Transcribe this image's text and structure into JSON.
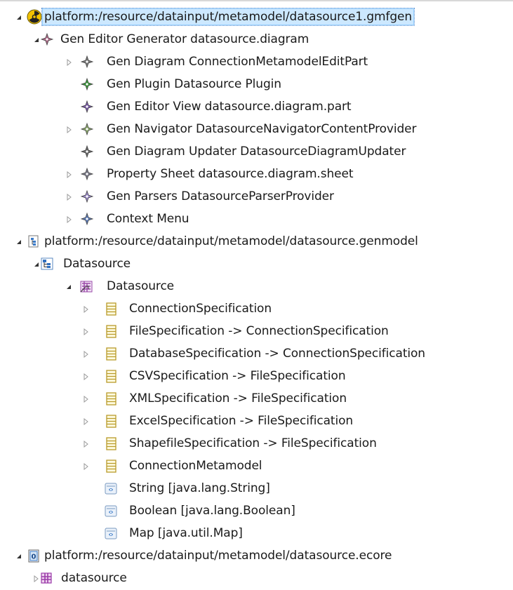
{
  "colors": {
    "gen_icon": "#6a6a9a",
    "green_icon": "#3a9a3a",
    "purple_icon": "#7a5aa8",
    "class_icon": "#b89a2a",
    "selection": "#cce8ff"
  },
  "tree": [
    {
      "icon": "radiation-icon",
      "expanded": true,
      "twisty": true,
      "label": "platform:/resource/datainput/metamodel/datasource1.gmfgen",
      "selected": true
    },
    {
      "icon": "gen-editor-generator-icon",
      "expanded": true,
      "twisty": true,
      "label": "Gen Editor Generator datasource.diagram"
    },
    {
      "icon": "gen-diagram-icon",
      "expanded": false,
      "twisty": true,
      "label": "Gen Diagram ConnectionMetamodelEditPart"
    },
    {
      "icon": "gen-plugin-icon",
      "expanded": false,
      "twisty": false,
      "label": "Gen Plugin Datasource Plugin"
    },
    {
      "icon": "gen-editor-view-icon",
      "expanded": false,
      "twisty": false,
      "label": "Gen Editor View datasource.diagram.part"
    },
    {
      "icon": "gen-navigator-icon",
      "expanded": false,
      "twisty": true,
      "label": "Gen Navigator DatasourceNavigatorContentProvider"
    },
    {
      "icon": "gen-diagram-updater-icon",
      "expanded": false,
      "twisty": false,
      "label": "Gen Diagram Updater DatasourceDiagramUpdater"
    },
    {
      "icon": "property-sheet-icon",
      "expanded": false,
      "twisty": true,
      "label": "Property Sheet datasource.diagram.sheet"
    },
    {
      "icon": "gen-parsers-icon",
      "expanded": false,
      "twisty": true,
      "label": "Gen Parsers DatasourceParserProvider"
    },
    {
      "icon": "context-menu-icon",
      "expanded": false,
      "twisty": true,
      "label": "Context Menu"
    },
    {
      "icon": "genmodel-file-icon",
      "expanded": true,
      "twisty": true,
      "label": "platform:/resource/datainput/metamodel/datasource.genmodel"
    },
    {
      "icon": "gen-package-icon",
      "expanded": true,
      "twisty": true,
      "label": "Datasource"
    },
    {
      "icon": "ecore-package-icon",
      "expanded": true,
      "twisty": true,
      "label": "Datasource"
    },
    {
      "icon": "class-icon",
      "expanded": false,
      "twisty": true,
      "label": "ConnectionSpecification"
    },
    {
      "icon": "class-icon",
      "expanded": false,
      "twisty": true,
      "label": "FileSpecification -> ConnectionSpecification"
    },
    {
      "icon": "class-icon",
      "expanded": false,
      "twisty": true,
      "label": "DatabaseSpecification -> ConnectionSpecification"
    },
    {
      "icon": "class-icon",
      "expanded": false,
      "twisty": true,
      "label": "CSVSpecification -> FileSpecification"
    },
    {
      "icon": "class-icon",
      "expanded": false,
      "twisty": true,
      "label": "XMLSpecification -> FileSpecification"
    },
    {
      "icon": "class-icon",
      "expanded": false,
      "twisty": true,
      "label": "ExcelSpecification -> FileSpecification"
    },
    {
      "icon": "class-icon",
      "expanded": false,
      "twisty": true,
      "label": "ShapefileSpecification -> FileSpecification"
    },
    {
      "icon": "class-icon",
      "expanded": false,
      "twisty": true,
      "label": "ConnectionMetamodel"
    },
    {
      "icon": "datatype-icon",
      "expanded": false,
      "twisty": false,
      "label": "String [java.lang.String]"
    },
    {
      "icon": "datatype-icon",
      "expanded": false,
      "twisty": false,
      "label": "Boolean [java.lang.Boolean]"
    },
    {
      "icon": "datatype-icon",
      "expanded": false,
      "twisty": false,
      "label": "Map [java.util.Map]"
    },
    {
      "icon": "ecore-file-icon",
      "expanded": true,
      "twisty": true,
      "label": "platform:/resource/datainput/metamodel/datasource.ecore"
    },
    {
      "icon": "epackage-icon",
      "expanded": false,
      "twisty": true,
      "label": "datasource"
    }
  ]
}
